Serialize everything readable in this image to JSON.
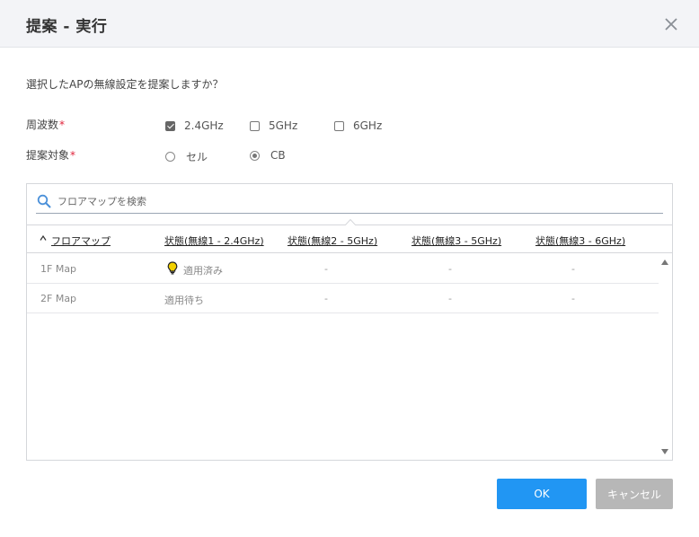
{
  "dialog": {
    "title": "提案 - 実行",
    "question": "選択したAPの無線設定を提案しますか？"
  },
  "frequency": {
    "label": "周波数",
    "required_mark": "*",
    "options": [
      {
        "label": "2.4GHz",
        "checked": true
      },
      {
        "label": "5GHz",
        "checked": false
      },
      {
        "label": "6GHz",
        "checked": false
      }
    ]
  },
  "target": {
    "label": "提案対象",
    "required_mark": "*",
    "options": [
      {
        "label": "セル",
        "selected": false
      },
      {
        "label": "CB",
        "selected": true
      }
    ]
  },
  "search": {
    "placeholder": "フロアマップを検索",
    "value": ""
  },
  "table": {
    "headers": [
      "フロアマップ",
      "状態(無線1 - 2.4GHz)",
      "状態(無線2 - 5GHz)",
      "状態(無線3 - 5GHz)",
      "状態(無線3 - 6GHz)"
    ],
    "sort": "ascending",
    "rows": [
      {
        "map": "1F Map",
        "radio1": "適用済み",
        "radio1_icon": "lightbulb-icon",
        "radio2": "-",
        "radio3_5": "-",
        "radio3_6": "-"
      },
      {
        "map": "2F Map",
        "radio1": "適用待ち",
        "radio1_icon": "",
        "radio2": "-",
        "radio3_5": "-",
        "radio3_6": "-"
      }
    ]
  },
  "buttons": {
    "ok": "OK",
    "cancel": "キャンセル"
  },
  "colors": {
    "primary": "#2196f3",
    "disabled": "#b7b7b7",
    "required": "#e0243b",
    "header_bg": "#f3f4f7",
    "bulb": "#f2d100"
  }
}
